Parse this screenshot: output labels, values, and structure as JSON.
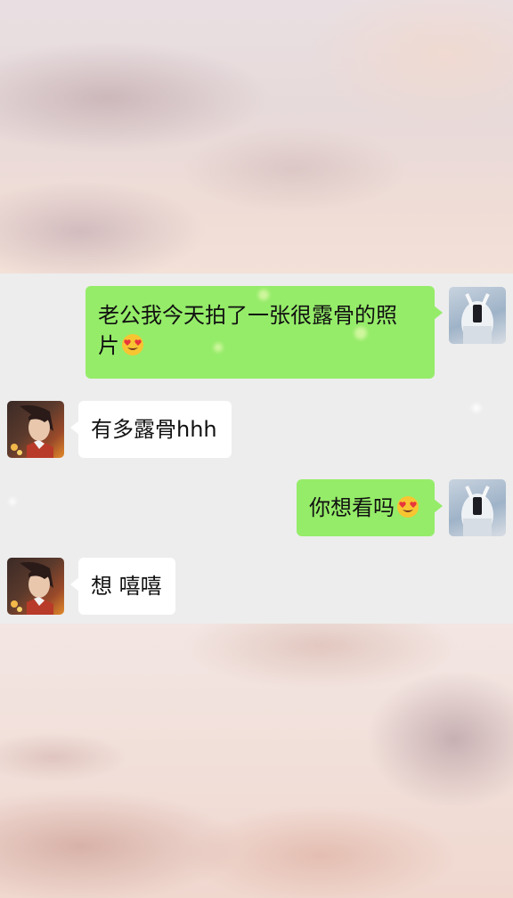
{
  "messages": [
    {
      "sender": "me",
      "text": "老公我今天拍了一张很露骨的照",
      "text2": "片",
      "emoji": "heart-eyes-emoji"
    },
    {
      "sender": "other",
      "text": "有多露骨hhh"
    },
    {
      "sender": "me",
      "text": "你想看吗",
      "emoji": "heart-eyes-emoji"
    },
    {
      "sender": "other",
      "text": "想 嘻嘻"
    }
  ],
  "colors": {
    "my_bubble": "#95ec69",
    "their_bubble": "#ffffff",
    "chat_background": "#ededed"
  }
}
